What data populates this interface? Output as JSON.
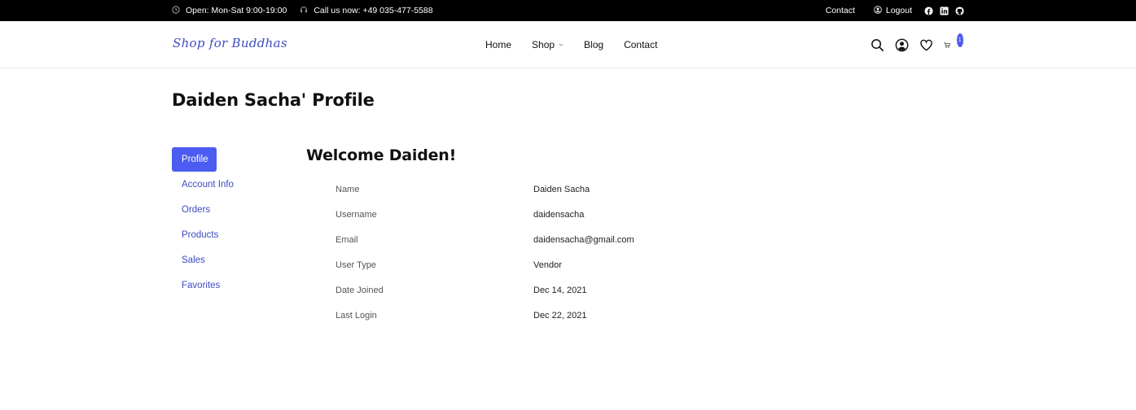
{
  "topbar": {
    "hours": "Open: Mon-Sat 9:00-19:00",
    "phone": "Call us now: +49 035-477-5588",
    "contact": "Contact",
    "logout": "Logout"
  },
  "header": {
    "logo": "Shop for Buddhas",
    "nav": {
      "home": "Home",
      "shop": "Shop",
      "blog": "Blog",
      "contact": "Contact"
    },
    "cart_count": "1"
  },
  "page": {
    "title": "Daiden Sacha' Profile",
    "welcome": "Welcome Daiden!"
  },
  "sidebar": {
    "items": [
      {
        "label": "Profile",
        "active": true
      },
      {
        "label": "Account Info"
      },
      {
        "label": "Orders"
      },
      {
        "label": "Products"
      },
      {
        "label": "Sales"
      },
      {
        "label": "Favorites"
      }
    ]
  },
  "profile": {
    "rows": [
      {
        "label": "Name",
        "value": "Daiden Sacha"
      },
      {
        "label": "Username",
        "value": "daidensacha"
      },
      {
        "label": "Email",
        "value": "daidensacha@gmail.com"
      },
      {
        "label": "User Type",
        "value": "Vendor"
      },
      {
        "label": "Date Joined",
        "value": "Dec 14, 2021"
      },
      {
        "label": "Last Login",
        "value": "Dec 22, 2021"
      }
    ]
  },
  "colors": {
    "accent": "#4c5cf0",
    "link": "#3f4cc2",
    "topbar": "#000000"
  }
}
